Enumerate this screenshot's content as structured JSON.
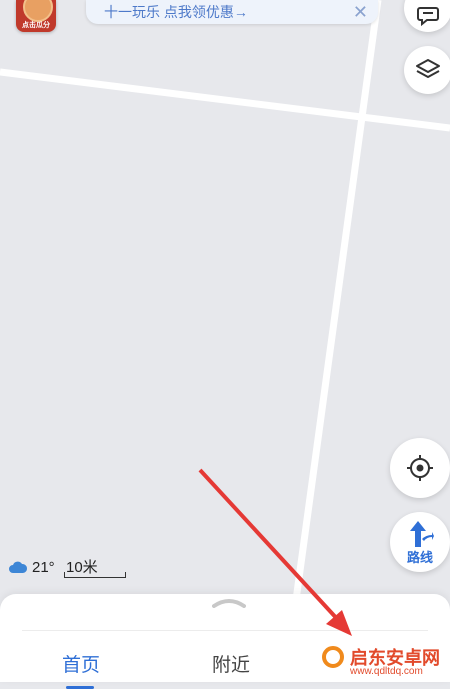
{
  "promo": {
    "badge_text": "点击瓜分",
    "banner_text": "十一玩乐  点我领优惠→",
    "close_glyph": "✕"
  },
  "map_controls": {
    "message_icon": "chat-bubble-icon",
    "layers_icon": "layers-icon",
    "locate_icon": "crosshair-icon",
    "route_icon": "route-arrow-icon",
    "route_label": "路线"
  },
  "weather": {
    "icon": "cloud-icon",
    "temperature": "21°"
  },
  "scale": {
    "label": "10米"
  },
  "bottom_sheet": {
    "tabs": [
      {
        "label": "首页",
        "active": true
      },
      {
        "label": "附近",
        "active": false
      }
    ]
  },
  "watermark": {
    "name": "启东安卓网",
    "url": "www.qdltdq.com"
  },
  "colors": {
    "accent": "#2f6fd6",
    "map_bg": "#e7e8ec",
    "annotation_arrow": "#e53935"
  }
}
